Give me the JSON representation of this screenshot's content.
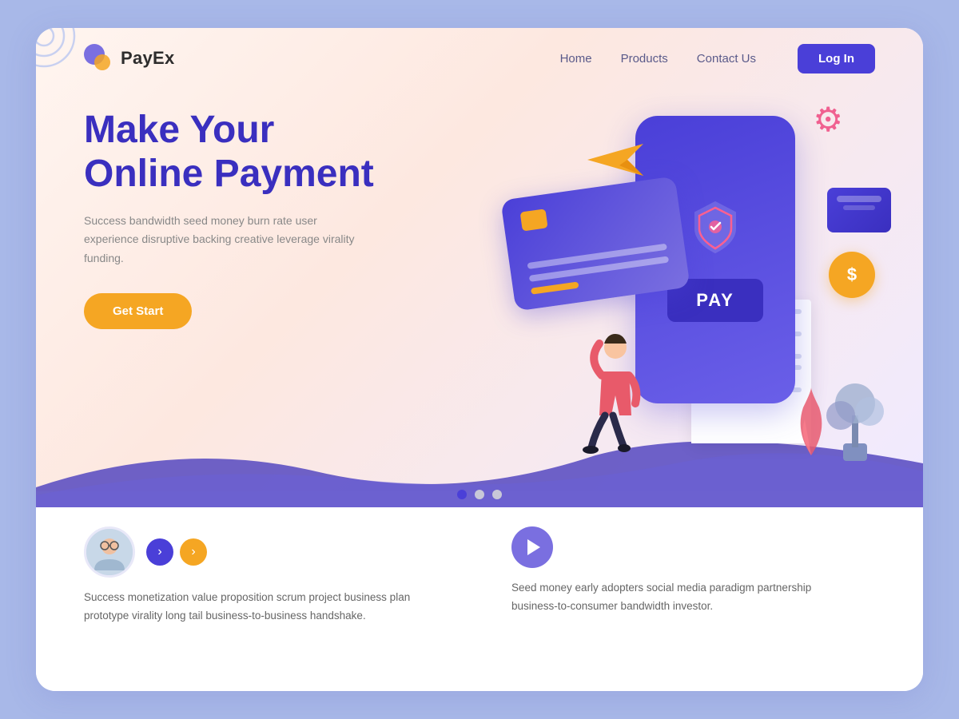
{
  "meta": {
    "background_color": "#a8b8e8",
    "card_background": "#ffffff"
  },
  "navbar": {
    "logo_text": "PayEx",
    "links": [
      {
        "id": "home",
        "label": "Home"
      },
      {
        "id": "products",
        "label": "Products"
      },
      {
        "id": "contact",
        "label": "Contact Us"
      }
    ],
    "login_label": "Log In"
  },
  "hero": {
    "title_line1": "Make Your",
    "title_line2": "Online Payment",
    "description": "Success bandwidth seed money burn rate user experience disruptive backing creative leverage virality funding.",
    "cta_label": "Get Start"
  },
  "illustration": {
    "pay_button_label": "PAY",
    "coin_symbol": "$"
  },
  "pagination": {
    "dots": [
      {
        "active": true
      },
      {
        "active": false
      },
      {
        "active": false
      }
    ]
  },
  "bottom": {
    "left_text": "Success monetization value proposition scrum project business plan prototype virality long tail business-to-business handshake.",
    "right_text": "Seed money early adopters social media paradigm partnership business-to-consumer bandwidth investor.",
    "prev_arrow": "‹",
    "next_arrow": "›"
  }
}
